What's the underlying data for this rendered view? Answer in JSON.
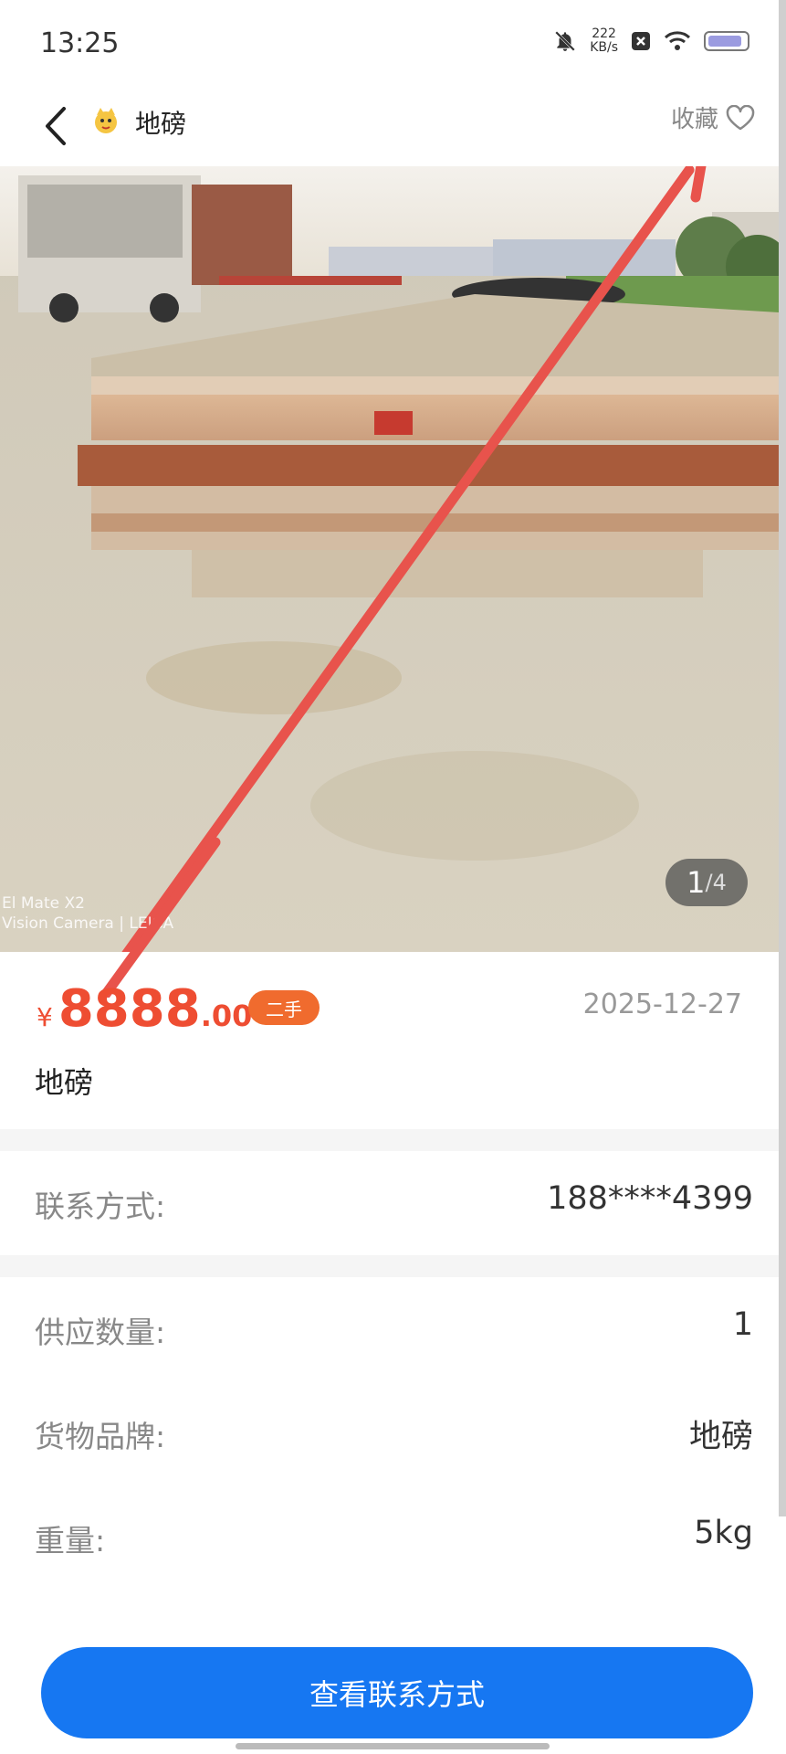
{
  "status_bar": {
    "time": "13:25",
    "speed_value": "222",
    "speed_unit": "KB/s"
  },
  "header": {
    "title": "地磅",
    "favorite_label": "收藏"
  },
  "gallery": {
    "current": "1",
    "total": "/4",
    "watermark_line1": "El Mate X2",
    "watermark_line2": "Vision Camera | LEICA"
  },
  "listing": {
    "currency": "¥",
    "price_int": "8888",
    "price_dec": ".00",
    "condition_badge": "二手",
    "date": "2025-12-27",
    "name": "地磅"
  },
  "details": [
    {
      "label": "联系方式:",
      "value": "188****4399"
    },
    {
      "label": "供应数量:",
      "value": "1"
    },
    {
      "label": "货物品牌:",
      "value": "地磅"
    },
    {
      "label": "重量:",
      "value": "5kg"
    }
  ],
  "cta_label": "查看联系方式",
  "colors": {
    "price": "#ee4d32",
    "badge": "#f06b2e",
    "cta": "#1677f2",
    "annotation_arrow": "#e8534c"
  },
  "icons": [
    "bell-off-icon",
    "close-box-icon",
    "wifi-icon",
    "battery-icon",
    "back-arrow-icon",
    "mascot-icon",
    "heart-outline-icon"
  ]
}
